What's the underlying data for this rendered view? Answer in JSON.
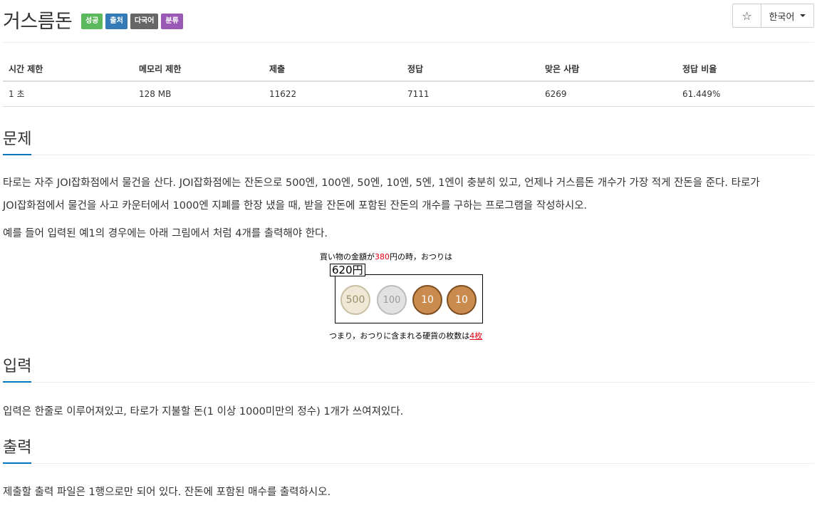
{
  "header": {
    "title": "거스름돈",
    "labels": [
      "성공",
      "출처",
      "다국어",
      "분류"
    ],
    "star": "☆",
    "language": "한국어"
  },
  "info_table": {
    "headers": [
      "시간 제한",
      "메모리 제한",
      "제출",
      "정답",
      "맞은 사람",
      "정답 비율"
    ],
    "values": [
      "1 초",
      "128 MB",
      "11622",
      "7111",
      "6269",
      "61.449%"
    ]
  },
  "problem": {
    "heading": "문제",
    "p1_line1": "타로는 자주 JOI잡화점에서 물건을 산다. JOI잡화점에는 잔돈으로 500엔, 100엔, 50엔, 10엔, 5엔, 1엔이 충분히 있고, 언제나 거스름돈 개수가 가장 적게 잔돈을 준다. 타로가",
    "p1_line2": "JOI잡화점에서 물건을 사고 카운터에서 1000엔 지폐를 한장 냈을 때, 받을 잔돈에 포함된 잔돈의 개수를 구하는 프로그램을 작성하시오.",
    "p2": "예를 들어 입력된 예1의 경우에는 아래 그림에서 처럼 4개를 출력해야 한다."
  },
  "figure": {
    "top_prefix": "買い物の金額が",
    "top_amount": "380",
    "top_suffix": "円の時，おつりは",
    "change": "620円",
    "coins": [
      "500",
      "100",
      "10",
      "10"
    ],
    "bottom_prefix": "つまり，おつりに含まれる硬貨の枚数は",
    "bottom_count": "4枚"
  },
  "input": {
    "heading": "입력",
    "text": "입력은 한줄로 이루어져있고, 타로가 지불할 돈(1 이상 1000미만의 정수) 1개가 쓰여져있다."
  },
  "output": {
    "heading": "출력",
    "text": "제출할 출력 파일은 1행으로만 되어 있다. 잔돈에 포함된 매수를 출력하시오."
  }
}
